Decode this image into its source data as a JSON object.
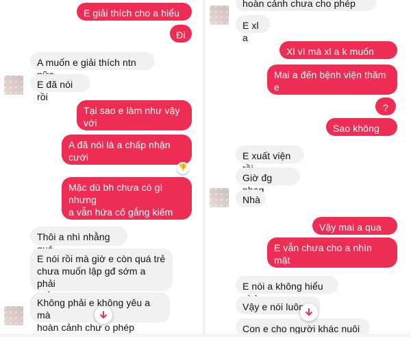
{
  "left_chat": {
    "messages": [
      {
        "type": "sent",
        "text": "E giải thích cho a hiểu đo"
      },
      {
        "type": "sent",
        "text": "Đi"
      },
      {
        "type": "received",
        "text": "A muốn e giải thích ntn nữa"
      },
      {
        "type": "received",
        "text": "E đã nói rồi"
      },
      {
        "type": "sent",
        "text": "Tại sao e làm như vậy với\nanh"
      },
      {
        "type": "sent",
        "text": "A đã nói là a chấp nhận cưới\ne và nuôi con"
      },
      {
        "type": "sent",
        "text": "Mặc dù bh chưa có gì nhưng\na vẫn hứa cố gắng kiếm tiền\nnuoi vk con mà"
      },
      {
        "type": "received",
        "text": "Thôi a nhì nhằng quá"
      },
      {
        "type": "received",
        "text": "E nói rồi mà giờ e còn quá trẻ\nchưa muốn lập gđ sớm a phải\nhiểu cho e chứ"
      },
      {
        "type": "received",
        "text": "Không phải e không yêu a mà\nhoàn cảnh chư    o phép"
      }
    ],
    "reaction_icon": "thumbs-down-reaction",
    "scroll_icon": "arrow-down-icon"
  },
  "right_chat": {
    "messages": [
      {
        "type": "received",
        "text": "hoàn cảnh chưa cho phép"
      },
      {
        "type": "received",
        "text": "E xl a"
      },
      {
        "type": "sent",
        "text": "Xl vì mà xl a k muốn nghe"
      },
      {
        "type": "sent",
        "text": "Mai a đến bệnh viện thăm e\nvà gặp con đc không"
      },
      {
        "type": "sent",
        "text": "?"
      },
      {
        "type": "sent",
        "text": "Sao không rep"
      },
      {
        "type": "received",
        "text": "E xuất viện rồi"
      },
      {
        "type": "received",
        "text": "Giờ đg nhag"
      },
      {
        "type": "received",
        "text": "Nhà"
      },
      {
        "type": "sent",
        "text": "Vậy mai a qua nhé"
      },
      {
        "type": "sent",
        "text": "E vẫn chưa cho a nhìn mặt\ncon"
      },
      {
        "type": "received",
        "text": "E nói a không hiểu gì à"
      },
      {
        "type": "received",
        "text": "Vậy e nói luôn"
      },
      {
        "type": "received",
        "text": "Con e cho người khác nuôi rồi"
      }
    ],
    "scroll_icon": "arrow-down-icon"
  },
  "colors": {
    "sent_bubble": "#ee2d55",
    "received_bubble": "#f1f1f2",
    "sent_text": "#ffffff",
    "received_text": "#111111"
  }
}
